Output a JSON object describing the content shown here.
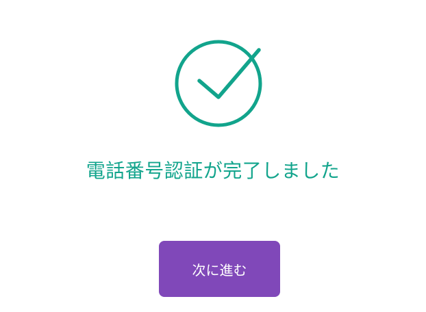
{
  "icon": {
    "name": "check-circle-icon",
    "color": "#12a48c"
  },
  "message": "電話番号認証が完了しました",
  "next_button": {
    "label": "次に進む",
    "color": "#8048b9"
  }
}
